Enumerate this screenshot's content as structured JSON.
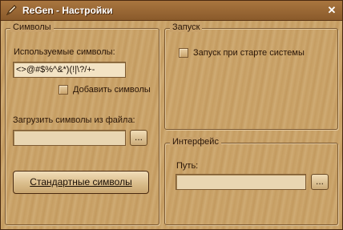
{
  "window": {
    "title": "ReGen - Настройки",
    "close_glyph": "✕"
  },
  "symbols_group": {
    "legend": "Символы",
    "used_symbols_label": "Используемые символы:",
    "used_symbols_value": "<>@#$%^&*)(!|\\?/+-",
    "add_symbols_label": "Добавить символы",
    "add_symbols_checked": false,
    "load_from_file_label": "Загрузить символы из файла:",
    "load_from_file_value": "",
    "browse_label": "...",
    "standard_button": "Стандартные символы"
  },
  "startup_group": {
    "legend": "Запуск",
    "startup_label": "Запуск при старте системы",
    "startup_checked": false
  },
  "interface_group": {
    "legend": "Интерфейс",
    "path_label": "Путь:",
    "path_value": "",
    "browse_label": "..."
  },
  "icons": {
    "app": "pen-icon",
    "close": "close-icon"
  }
}
